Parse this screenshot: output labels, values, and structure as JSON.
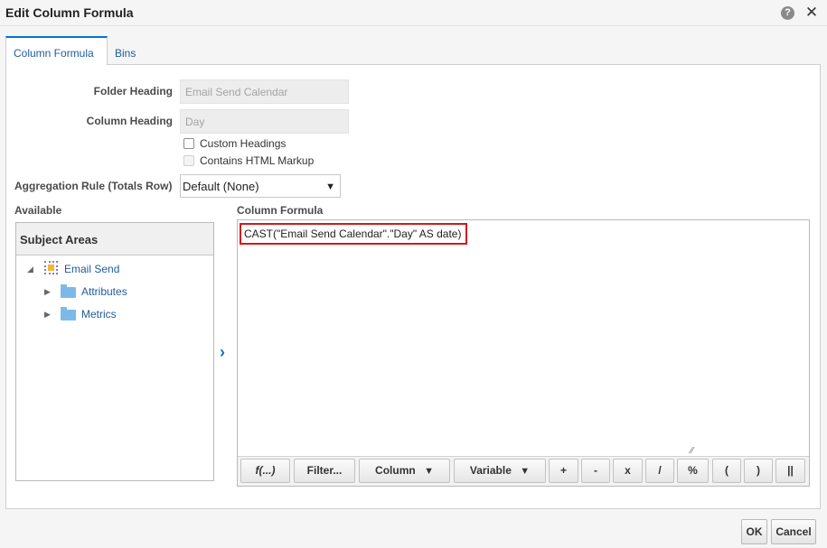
{
  "dialog": {
    "title": "Edit Column Formula",
    "help_symbol": "?",
    "close_symbol": "✕"
  },
  "tabs": [
    {
      "label": "Column Formula",
      "active": true
    },
    {
      "label": "Bins",
      "active": false
    }
  ],
  "form": {
    "folder_heading_label": "Folder Heading",
    "folder_heading_value": "Email Send Calendar",
    "column_heading_label": "Column Heading",
    "column_heading_value": "Day",
    "custom_headings_label": "Custom Headings",
    "custom_headings_checked": false,
    "html_markup_label": "Contains HTML Markup",
    "html_markup_checked": false,
    "html_markup_enabled": false,
    "aggregation_label": "Aggregation Rule (Totals Row)",
    "aggregation_value": "Default (None)"
  },
  "available": {
    "label": "Available",
    "subject_areas_title": "Subject Areas",
    "tree": {
      "root": "Email Send",
      "children": [
        "Attributes",
        "Metrics"
      ]
    }
  },
  "formula": {
    "label": "Column Formula",
    "text": "CAST(\"Email Send Calendar\".\"Day\" AS date)",
    "toolbar": {
      "function": "f(...)",
      "filter": "Filter...",
      "column": "Column",
      "variable": "Variable",
      "plus": "+",
      "minus": "-",
      "multiply": "x",
      "divide": "/",
      "percent": "%",
      "open_paren": "(",
      "close_paren": ")",
      "concat": "||",
      "dropdown_arrow": "▼"
    }
  },
  "buttons": {
    "ok": "OK",
    "cancel": "Cancel"
  },
  "colors": {
    "accent": "#0572ce",
    "link": "#1f5c99",
    "highlight_border": "#d3191c"
  }
}
